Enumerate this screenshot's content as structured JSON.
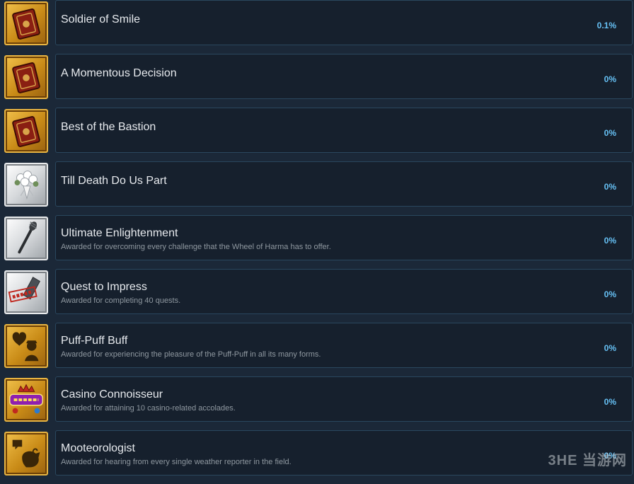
{
  "achievements": [
    {
      "title": "Soldier of Smile",
      "description": "",
      "percent": "0.1%",
      "icon": "book-icon"
    },
    {
      "title": "A Momentous Decision",
      "description": "",
      "percent": "0%",
      "icon": "book-icon"
    },
    {
      "title": "Best of the Bastion",
      "description": "",
      "percent": "0%",
      "icon": "book-icon"
    },
    {
      "title": "Till Death Do Us Part",
      "description": "",
      "percent": "0%",
      "icon": "bouquet-icon"
    },
    {
      "title": "Ultimate Enlightenment",
      "description": "Awarded for overcoming every challenge that the Wheel of Harma has to offer.",
      "percent": "0%",
      "icon": "staff-icon"
    },
    {
      "title": "Quest to Impress",
      "description": "Awarded for completing 40 quests.",
      "percent": "0%",
      "icon": "clear-stamp-icon"
    },
    {
      "title": "Puff-Puff Buff",
      "description": "Awarded for experiencing the pleasure of the Puff-Puff in all its many forms.",
      "percent": "0%",
      "icon": "puff-silhouette-icon"
    },
    {
      "title": "Casino Connoisseur",
      "description": "Awarded for attaining 10 casino-related accolades.",
      "percent": "0%",
      "icon": "casino-icon"
    },
    {
      "title": "Mooteorologist",
      "description": "Awarded for hearing from every single weather reporter in the field.",
      "percent": "0%",
      "icon": "cow-icon"
    }
  ],
  "watermark": "3HE 当游网",
  "colors": {
    "background": "#1b2838",
    "card": "#16202d",
    "card_border": "#2a475e",
    "percent": "#66c0f4",
    "gold_icon": "#d9a02b",
    "silver_icon": "#d6d9dc"
  }
}
